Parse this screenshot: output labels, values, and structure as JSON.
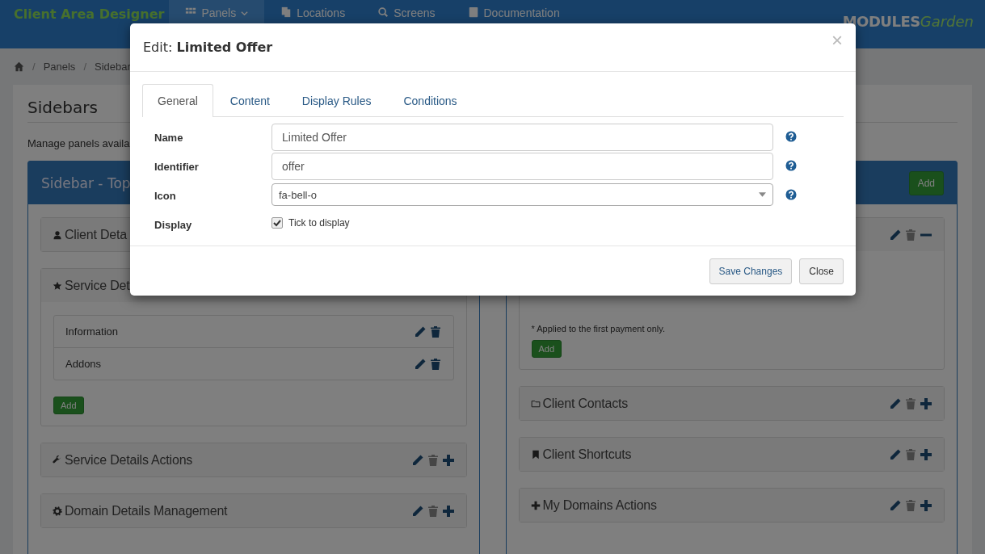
{
  "header": {
    "brand": "Client Area Designer",
    "nav": [
      {
        "label": "Panels",
        "selected": true,
        "kind": "grid",
        "caret": true
      },
      {
        "label": "Locations",
        "selected": false,
        "kind": "files",
        "caret": false
      },
      {
        "label": "Screens",
        "selected": false,
        "kind": "search",
        "caret": false
      },
      {
        "label": "Documentation",
        "selected": false,
        "kind": "book",
        "caret": false
      }
    ],
    "logo": {
      "strong": "MODULES",
      "light": "Garden"
    }
  },
  "breadcrumb": [
    {
      "sep": "/",
      "label": "Panels"
    },
    {
      "sep": "/",
      "label": "Sidebar"
    }
  ],
  "page": {
    "title": "Sidebars",
    "description": "Manage panels availa"
  },
  "columns": [
    {
      "title": "Sidebar - Top",
      "panels": [
        {
          "kind": "user",
          "title": "Client Deta"
        },
        {
          "kind": "star",
          "title": "Service Det",
          "items": [
            "Information",
            "Addons"
          ],
          "add": "Add"
        },
        {
          "kind": "wrench",
          "title": "Service Details Actions",
          "expanded": false
        },
        {
          "kind": "cog",
          "title": "Domain Details Management",
          "expanded": false
        }
      ]
    },
    {
      "add": "Add",
      "panels": [
        {
          "kind": "blank",
          "expanded": true,
          "note": "* Applied to the first payment only.",
          "add": "Add"
        },
        {
          "kind": "folder",
          "title": "Client Contacts",
          "expanded": false
        },
        {
          "kind": "bookmark",
          "title": "Client Shortcuts",
          "expanded": false
        },
        {
          "kind": "plus",
          "title": "My Domains Actions",
          "expanded": false
        }
      ]
    }
  ],
  "modal": {
    "prefix": "Edit:",
    "title": "Limited Offer",
    "close": "×",
    "tabs": [
      {
        "label": "General",
        "selected": true
      },
      {
        "label": "Content",
        "selected": false
      },
      {
        "label": "Display Rules",
        "selected": false
      },
      {
        "label": "Conditions",
        "selected": false
      }
    ],
    "fields": [
      {
        "kind": "text",
        "label": "Name",
        "value": "Limited Offer"
      },
      {
        "kind": "text",
        "label": "Identifier",
        "value": "offer"
      },
      {
        "kind": "select",
        "label": "Icon",
        "value": "fa-bell-o"
      },
      {
        "kind": "checkbox",
        "label": "Display",
        "text": "Tick to display",
        "checked": true
      }
    ],
    "buttons": [
      {
        "label": "Save Changes",
        "kind": "primary"
      },
      {
        "label": "Close",
        "kind": "default"
      }
    ]
  }
}
